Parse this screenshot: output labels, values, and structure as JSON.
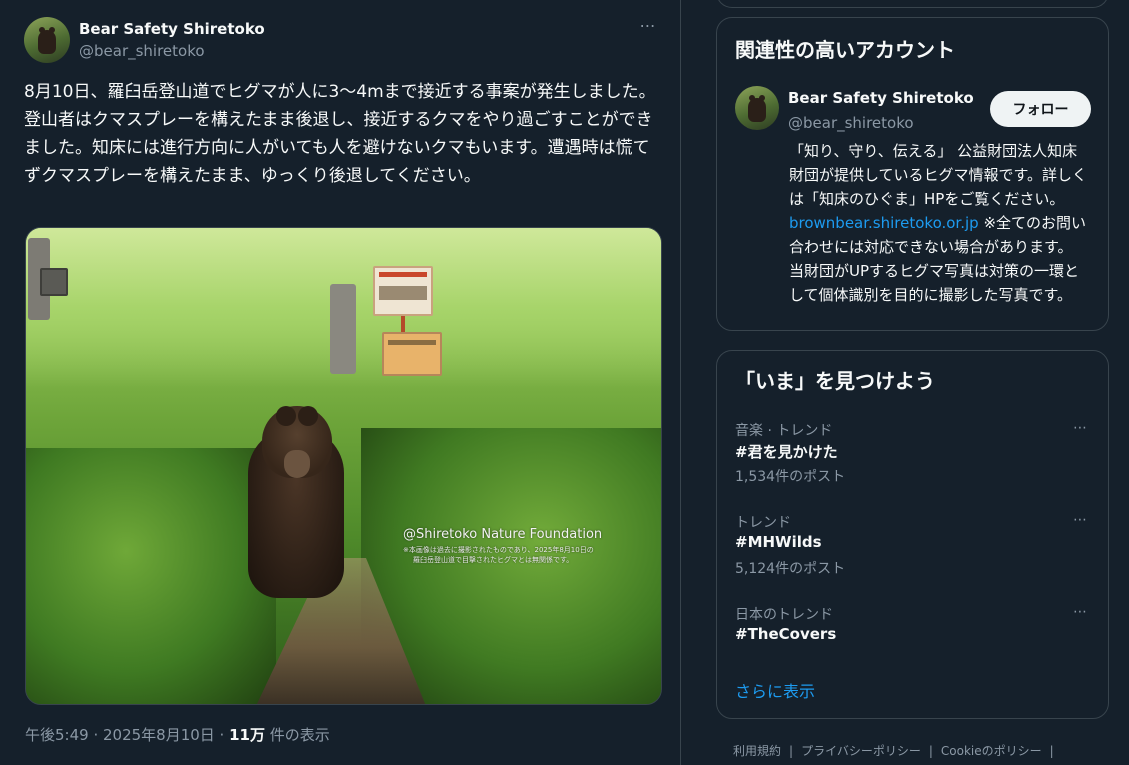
{
  "tweet": {
    "author_name": "Bear Safety Shiretoko",
    "author_handle": "@bear_shiretoko",
    "more_icon": "⋯",
    "text": "8月10日、羅臼岳登山道でヒグマが人に3〜4mまで接近する事案が発生しました。登山者はクマスプレーを構えたまま後退し、接近するクマをやり過ごすことができました。知床には進行方向に人がいても人を避けないクマもいます。遭遇時は慌てずクマスプレーを構えたまま、ゆっくり後退してください。",
    "photo": {
      "credit": "@Shiretoko Nature Foundation",
      "note_line1": "※本画像は過去に撮影されたものであり、2025年8月10日の",
      "note_line2": "羅臼岳登山道で目撃されたヒグマとは無関係です。"
    },
    "timestamp": "午後5:49 · 2025年8月10日 · ",
    "views_count": "11万",
    "views_label": " 件の表示"
  },
  "sidebar": {
    "related": {
      "title": "関連性の高いアカウント",
      "account": {
        "name": "Bear Safety Shiretoko",
        "handle": "@bear_shiretoko",
        "follow_label": "フォロー",
        "bio_before_link": "「知り、守り、伝える」 公益財団法人知床財団が提供しているヒグマ情報です。詳しくは「知床のひぐま」HPをご覧ください。",
        "bio_link": "brownbear.shiretoko.or.jp",
        "bio_after_link": " ※全てのお問い合わせには対応できない場合があります。 当財団がUPするヒグマ写真は対策の一環として個体識別を目的に撮影した写真です。"
      }
    },
    "trends": {
      "title": "「いま」を見つけよう",
      "items": [
        {
          "context": "音楽 · トレンド",
          "name": "#君を見かけた",
          "count": "1,534件のポスト"
        },
        {
          "context": "トレンド",
          "name": "#MHWilds",
          "count": "5,124件のポスト"
        },
        {
          "context": "日本のトレンド",
          "name": "#TheCovers",
          "count": ""
        }
      ],
      "more_icon": "⋯",
      "show_more": "さらに表示"
    },
    "footer": {
      "links": [
        "利用規約",
        "プライバシーポリシー",
        "Cookieのポリシー"
      ],
      "separator": "|"
    }
  },
  "colors": {
    "background": "#15202b",
    "border": "#38444d",
    "text_primary": "#f7f9f9",
    "text_secondary": "#8b98a5",
    "accent": "#1d9bf0"
  }
}
